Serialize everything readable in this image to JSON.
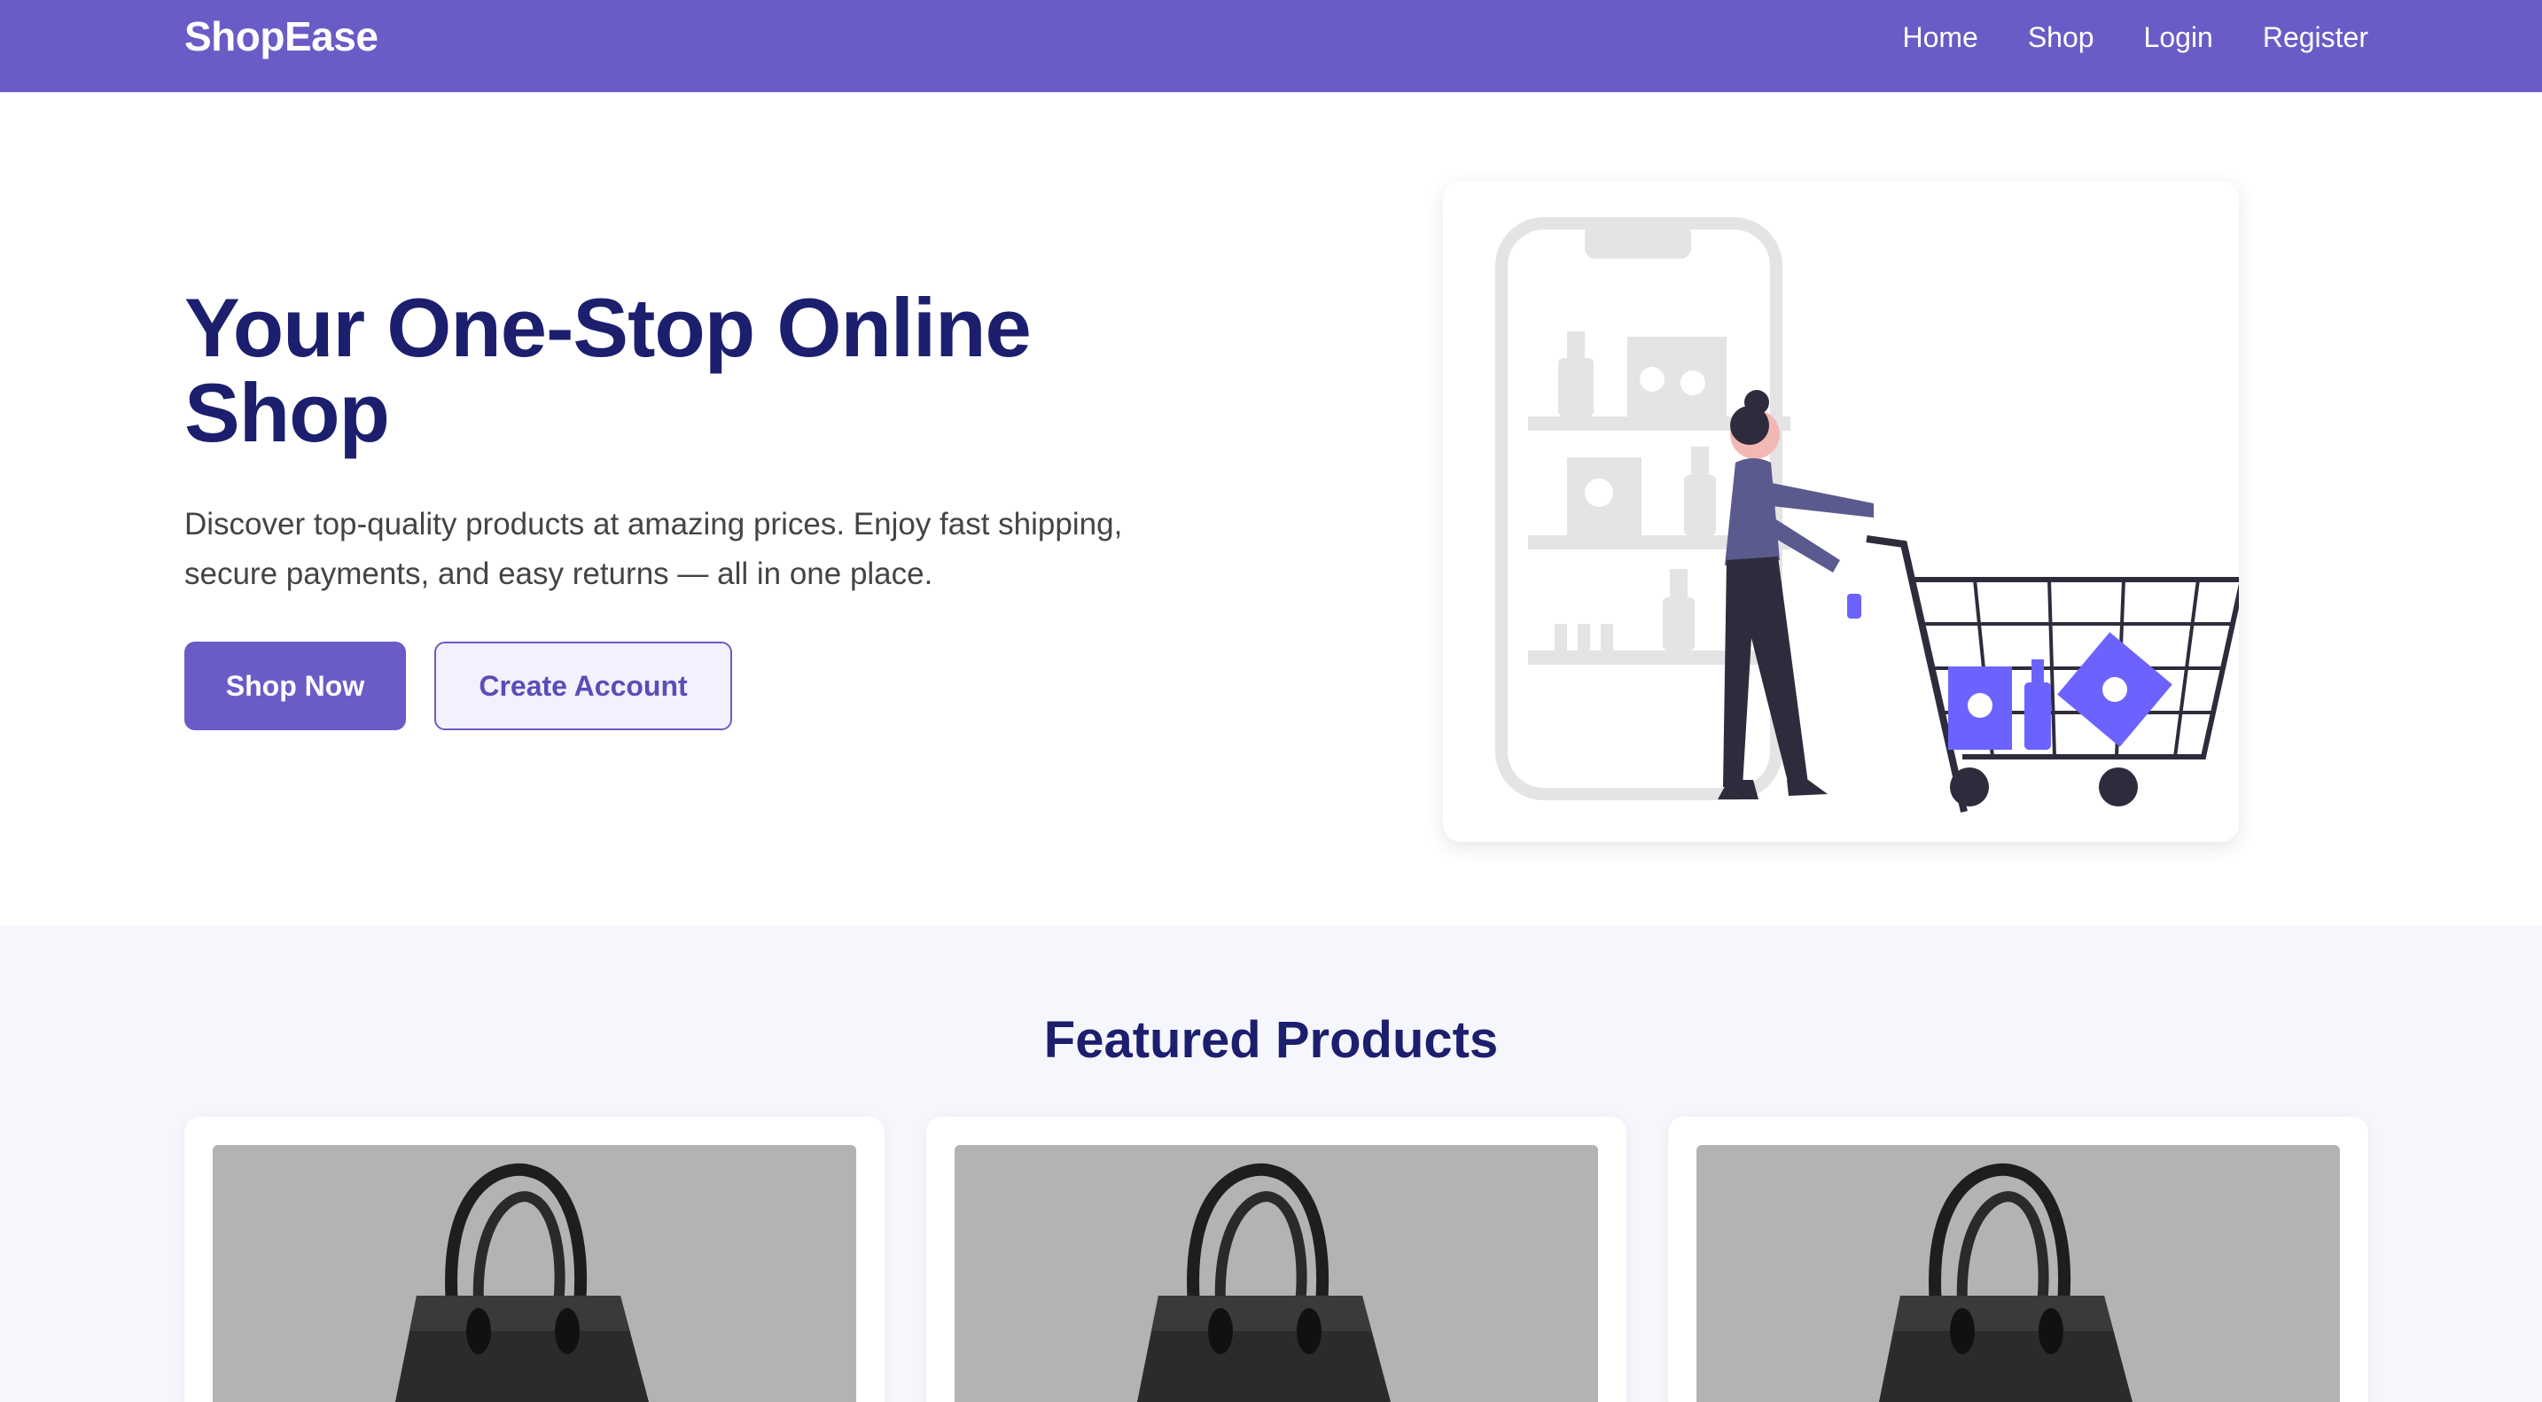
{
  "navbar": {
    "brand": "ShopEase",
    "links": [
      {
        "label": "Home"
      },
      {
        "label": "Shop"
      },
      {
        "label": "Login"
      },
      {
        "label": "Register"
      }
    ],
    "background": "#6a5cc6"
  },
  "hero": {
    "title": "Your One-Stop Online Shop",
    "description": "Discover top-quality products at amazing prices. Enjoy fast shipping, secure payments, and easy returns — all in one place.",
    "primary_button": "Shop Now",
    "secondary_button": "Create Account",
    "illustration": "woman-with-shopping-cart-illustration"
  },
  "featured": {
    "title": "Featured Products",
    "products": [
      {
        "image": "black-handbag-image"
      },
      {
        "image": "black-handbag-image"
      },
      {
        "image": "black-handbag-image"
      }
    ]
  },
  "colors": {
    "accent": "#6a5cc6",
    "heading": "#1c1f6e",
    "section_bg": "#f6f7fc"
  }
}
